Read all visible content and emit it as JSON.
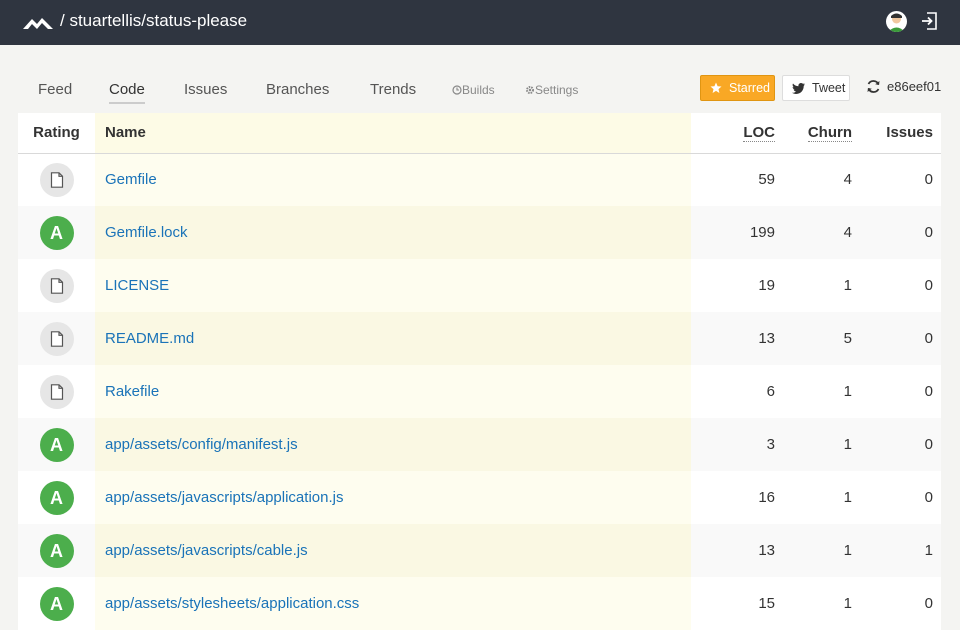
{
  "header": {
    "repo_path": "/ stuartellis/status-please"
  },
  "nav": {
    "tabs": [
      {
        "label": "Feed"
      },
      {
        "label": "Code"
      },
      {
        "label": "Issues"
      },
      {
        "label": "Branches"
      },
      {
        "label": "Trends"
      }
    ],
    "builds_label": "Builds",
    "settings_label": "Settings",
    "starred_label": "Starred",
    "tweet_label": "Tweet",
    "commit": "e86eef01"
  },
  "table": {
    "headers": {
      "rating": "Rating",
      "name": "Name",
      "loc": "LOC",
      "churn": "Churn",
      "issues": "Issues"
    },
    "rows": [
      {
        "rating": "",
        "name": "Gemfile",
        "loc": "59",
        "churn": "4",
        "issues": "0"
      },
      {
        "rating": "A",
        "name": "Gemfile.lock",
        "loc": "199",
        "churn": "4",
        "issues": "0"
      },
      {
        "rating": "",
        "name": "LICENSE",
        "loc": "19",
        "churn": "1",
        "issues": "0"
      },
      {
        "rating": "",
        "name": "README.md",
        "loc": "13",
        "churn": "5",
        "issues": "0"
      },
      {
        "rating": "",
        "name": "Rakefile",
        "loc": "6",
        "churn": "1",
        "issues": "0"
      },
      {
        "rating": "A",
        "name": "app/assets/config/manifest.js",
        "loc": "3",
        "churn": "1",
        "issues": "0"
      },
      {
        "rating": "A",
        "name": "app/assets/javascripts/application.js",
        "loc": "16",
        "churn": "1",
        "issues": "0"
      },
      {
        "rating": "A",
        "name": "app/assets/javascripts/cable.js",
        "loc": "13",
        "churn": "1",
        "issues": "1"
      },
      {
        "rating": "A",
        "name": "app/assets/stylesheets/application.css",
        "loc": "15",
        "churn": "1",
        "issues": "0"
      }
    ]
  },
  "colors": {
    "topbar": "#2f3540",
    "grade_a": "#4cae4c",
    "starred": "#f9a825",
    "link": "#1a73b8"
  }
}
